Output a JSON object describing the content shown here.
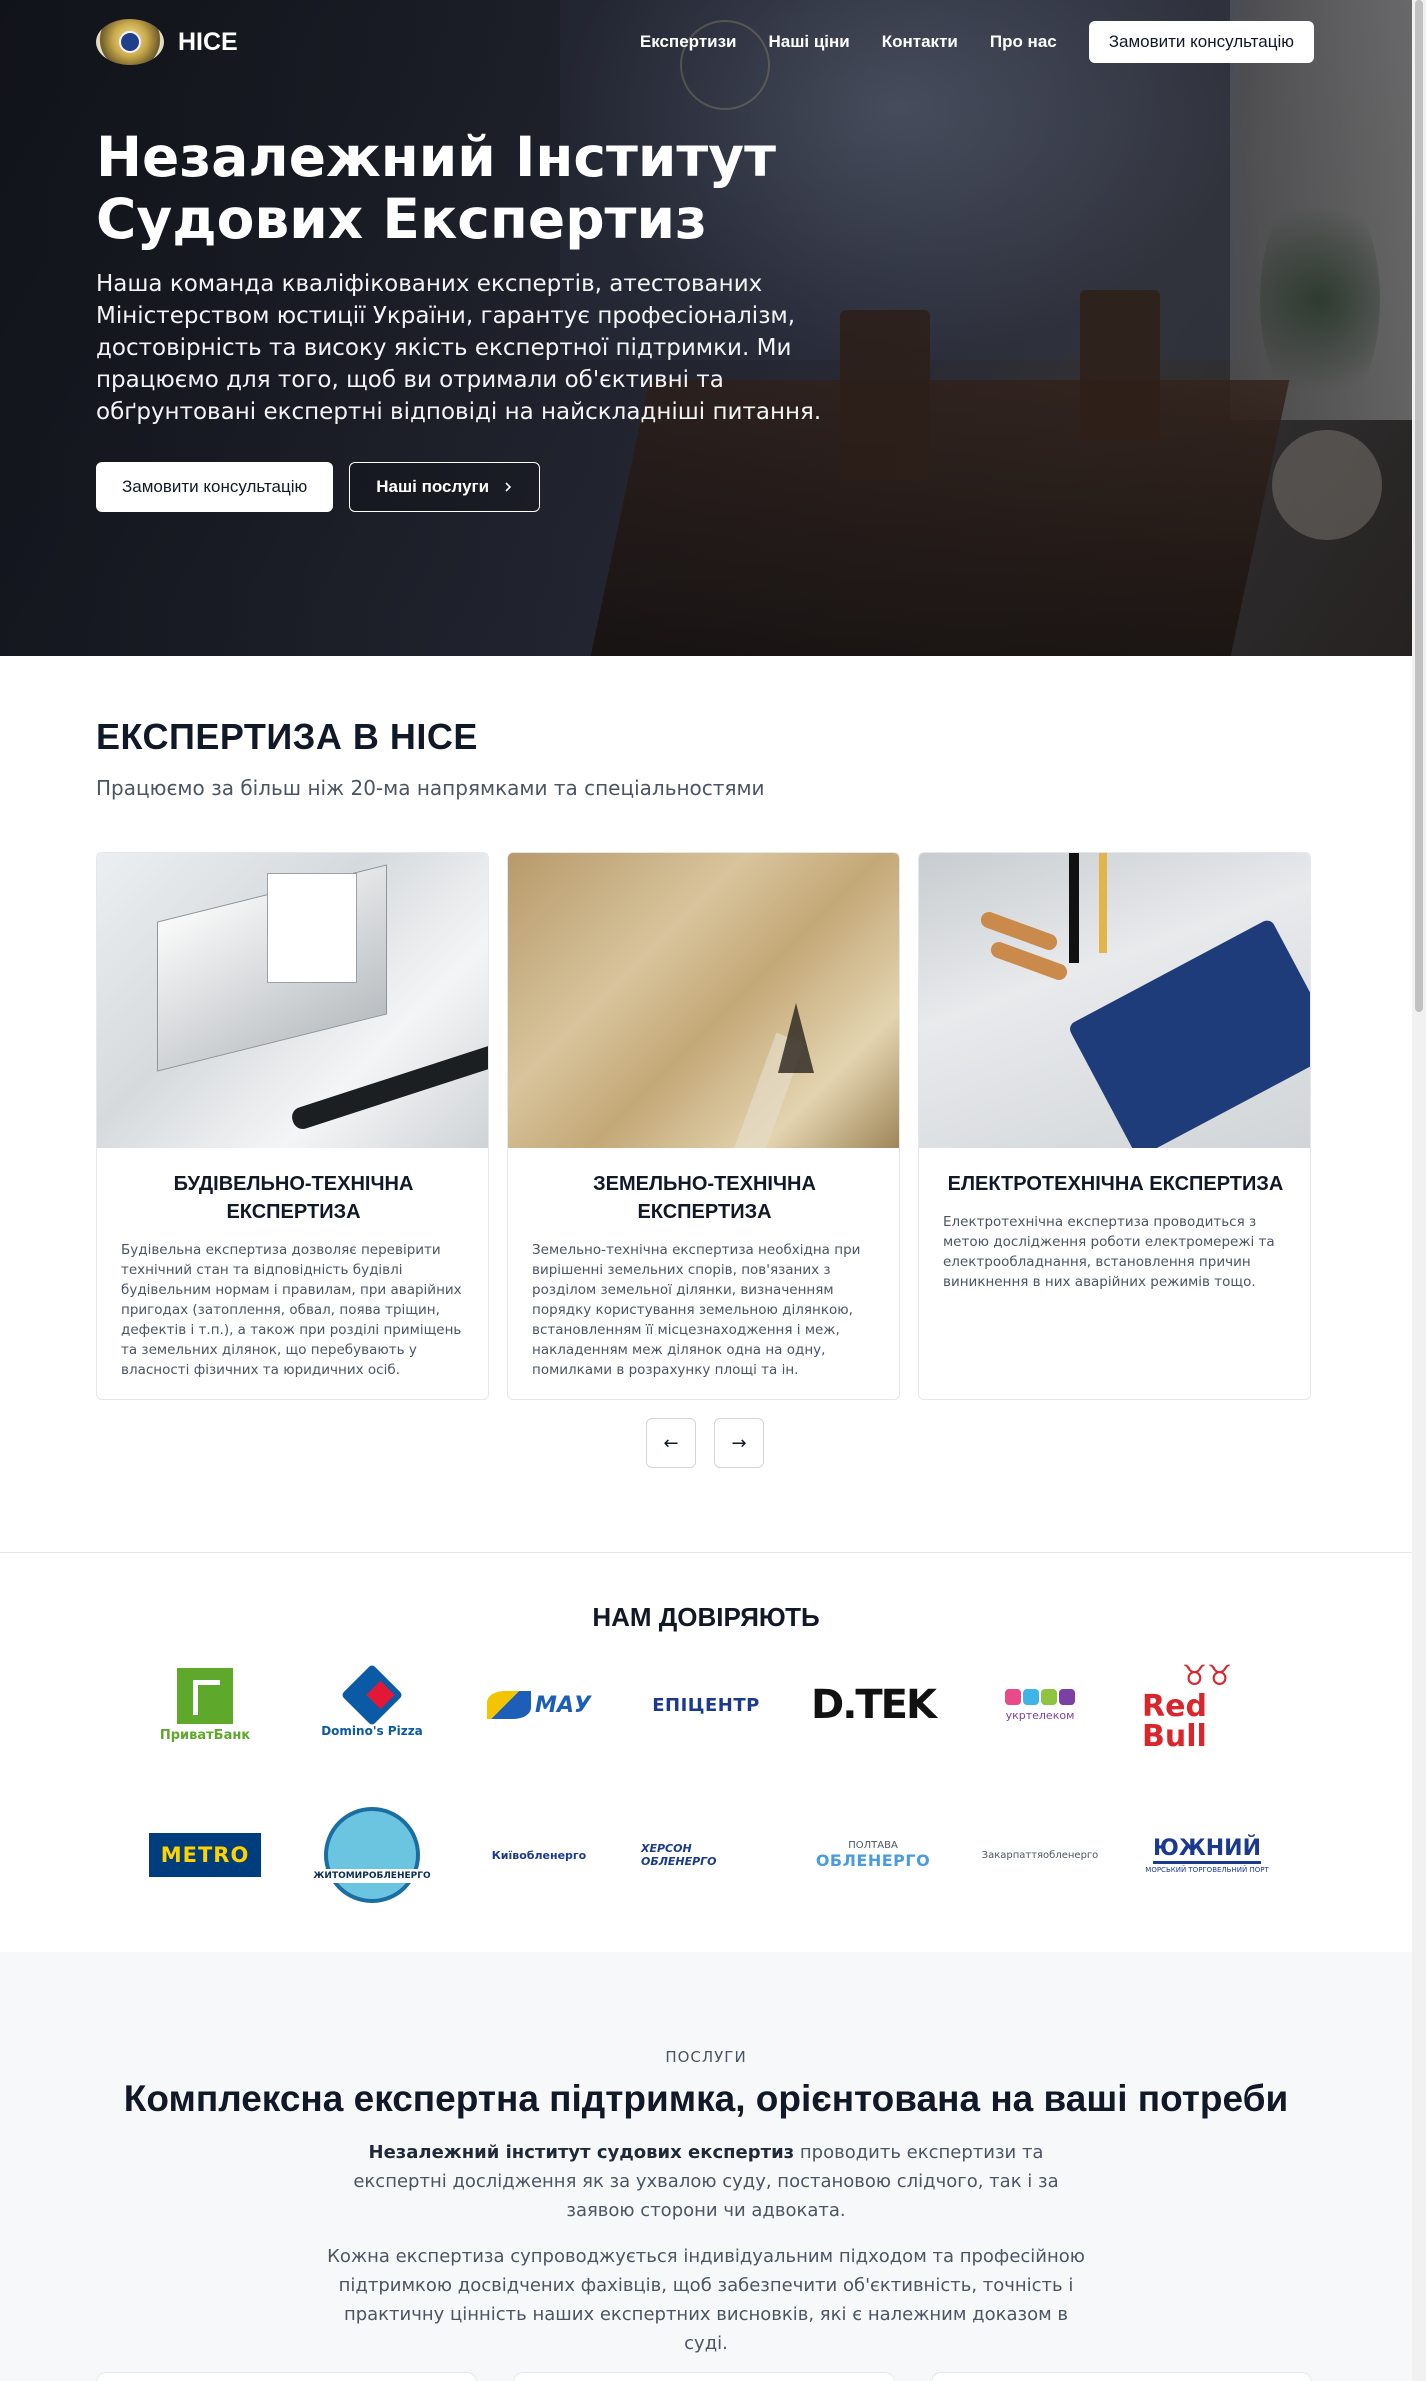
{
  "nav": {
    "brand": "НІСЕ",
    "links": [
      "Експертизи",
      "Наші ціни",
      "Контакти",
      "Про нас"
    ],
    "cta": "Замовити консультацію"
  },
  "hero": {
    "title": "Незалежний Інститут Судових Експертиз",
    "text": "Наша команда кваліфікованих експертів, атестованих Міністерством юстиції України, гарантує професіоналізм, достовірність та високу якість експертної підтримки. Ми працюємо для того, щоб ви отримали об'єктивні та обґрунтовані експертні відповіді на найскладніші питання.",
    "primary_button": "Замовити консультацію",
    "secondary_button": "Наші послуги"
  },
  "expertise": {
    "title": "ЕКСПЕРТИЗА В НІСЕ",
    "subtitle": "Працюємо за більш ніж 20-ма напрямками та спеціальностями",
    "cards": [
      {
        "title": "БУДІВЕЛЬНО-ТЕХНІЧНА ЕКСПЕРТИЗА",
        "text": "Будівельна експертиза дозволяє перевірити технічний стан та відповідність будівлі будівельним нормам і правилам, при аварійних пригодах (затоплення, обвал, поява тріщин, дефектів і т.п.), а також при розділі приміщень та земельних ділянок, що перебувають у власності фізичних та юридичних осіб."
      },
      {
        "title": "ЗЕМЕЛЬНО-ТЕХНІЧНА ЕКСПЕРТИЗА",
        "text": "Земельно-технічна експертиза необхідна при вирішенні земельних спорів, пов'язаних з розділом земельної ділянки, визначенням порядку користування земельною ділянкою, встановленням її місцезнаходження і меж, накладенням меж ділянок одна на одну, помилками в розрахунку площі та ін."
      },
      {
        "title": "ЕЛЕКТРОТЕХНІЧНА ЕКСПЕРТИЗА",
        "text": "Електротехнічна експертиза проводиться з метою дослідження роботи електромережі та електрообладнання, встановлення причин виникнення в них аварійних режимів тощо."
      }
    ],
    "prev_icon": "←",
    "next_icon": "→"
  },
  "trust": {
    "title": "НАМ ДОВІРЯЮТЬ",
    "logos": {
      "privat": "ПриватБанк",
      "dominos": "Domino's Pizza",
      "mau": "МАУ",
      "epicentr": "ЕПІЦЕНТР",
      "dtek": "D.TEK",
      "ukrtelecom": "укртелеком",
      "redbull": "Red Bull",
      "metro": "METRO",
      "zhytomyr": "ЖИТОМИРОБЛЕНЕРГО",
      "kyiv": "Київобленерго",
      "kherson": "ХЕРСОН ОБЛЕНЕРГО",
      "poltava": "ОБЛЕНЕРГО",
      "poltava_top": "ПОЛТАВА",
      "zakarpattia": "Закарпаттяобленерго",
      "yuzhny": "ЮЖНИЙ",
      "yuzhny_sub": "МОРСЬКИЙ ТОРГОВЕЛЬНИЙ ПОРТ"
    }
  },
  "services": {
    "eyebrow": "ПОСЛУГИ",
    "title": "Комплексна експертна підтримка, орієнтована на ваші потреби",
    "p1_strong": "Незалежний інститут судових експертиз",
    "p1_rest": " проводить експертизи та експертні дослідження як за ухвалою суду, постановою слідчого, так і за заявою сторони чи адвоката.",
    "p2": "Кожна експертиза супроводжується індивідуальним підходом та професійною підтримкою досвідчених фахівців, щоб забезпечити об'єктивність, точність і практичну цінність наших експертних висновків, які є належним доказом в суді."
  },
  "colors": {
    "privat_green": "#5ea82c",
    "dominos_blue": "#0b5aa6",
    "redbull_red": "#d9262c",
    "metro_blue": "#003d7c",
    "metro_yellow": "#ffd200"
  }
}
